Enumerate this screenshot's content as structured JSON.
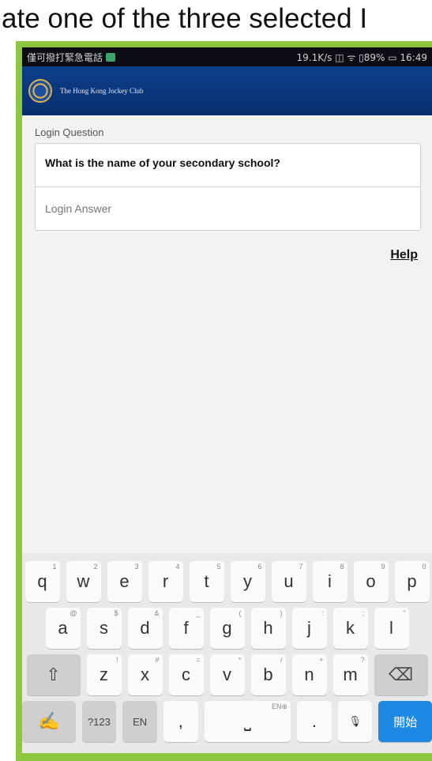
{
  "caption": "ate one of the three selected I",
  "status": {
    "carrier": "僅可撥打緊急電話",
    "right": "19.1K/s ◫ ᯤ ▯89% ▭ 16:49"
  },
  "app": {
    "name": "The Hong Kong Jockey Club"
  },
  "form": {
    "question_label": "Login Question",
    "question": "What is the name of your secondary school?",
    "answer_placeholder": "Login Answer",
    "help": "Help"
  },
  "keyboard": {
    "row1": [
      {
        "k": "q",
        "s": "1"
      },
      {
        "k": "w",
        "s": "2"
      },
      {
        "k": "e",
        "s": "3"
      },
      {
        "k": "r",
        "s": "4"
      },
      {
        "k": "t",
        "s": "5"
      },
      {
        "k": "y",
        "s": "6"
      },
      {
        "k": "u",
        "s": "7"
      },
      {
        "k": "i",
        "s": "8"
      },
      {
        "k": "o",
        "s": "9"
      },
      {
        "k": "p",
        "s": "0"
      }
    ],
    "row2": [
      {
        "k": "a",
        "s": "@"
      },
      {
        "k": "s",
        "s": "$"
      },
      {
        "k": "d",
        "s": "&"
      },
      {
        "k": "f",
        "s": "_"
      },
      {
        "k": "g",
        "s": "("
      },
      {
        "k": "h",
        "s": ")"
      },
      {
        "k": "j",
        "s": ":"
      },
      {
        "k": "k",
        "s": ";"
      },
      {
        "k": "l",
        "s": "\""
      }
    ],
    "row3": [
      {
        "k": "z",
        "s": "!"
      },
      {
        "k": "x",
        "s": "#"
      },
      {
        "k": "c",
        "s": "="
      },
      {
        "k": "v",
        "s": "*"
      },
      {
        "k": "b",
        "s": "/"
      },
      {
        "k": "n",
        "s": "+"
      },
      {
        "k": "m",
        "s": "?"
      }
    ],
    "shift": "⇧",
    "backspace": "⌫",
    "handwrite": "✍",
    "num": "?123",
    "lang": "EN",
    "comma": ",",
    "space": "⎵",
    "space_hint": "EN⊕",
    "period": ".",
    "mic": "🎙",
    "go": "開始"
  }
}
